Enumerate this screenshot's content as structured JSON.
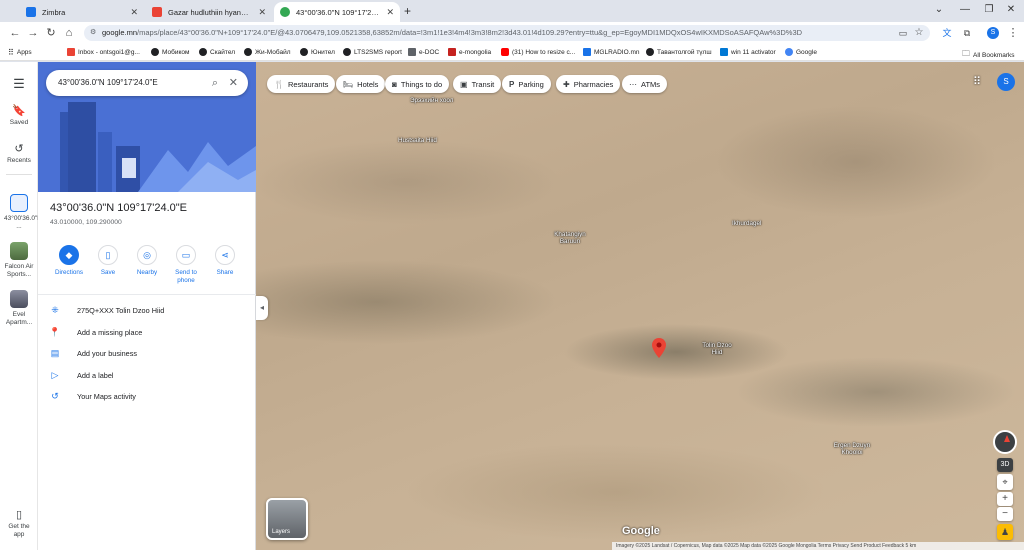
{
  "tabs": [
    {
      "title": "Zimbra",
      "icon_color": "#1a73e8",
      "active": false
    },
    {
      "title": "Gazar hudluthiin hyanasan medee",
      "icon_color": "#ea4335",
      "active": false
    },
    {
      "title": "43°00'36.0\"N 109°17'24.0\"E - Go",
      "icon_color": "#34a853",
      "active": true
    }
  ],
  "new_tab_label": "+",
  "window_controls": {
    "down": "⌄",
    "minimize": "—",
    "maximize": "❐",
    "close": "✕"
  },
  "address": {
    "host": "google.mn",
    "rest": "/maps/place/43°00'36.0\"N+109°17'24.0\"E/@43.0706479,109.0521358,63852m/data=!3m1!1e3!4m4!3m3!8m2!3d43.01!4d109.29?entry=ttu&g_ep=EgoyMDI1MDQxOS4wIKXMDSoASAFQAw%3D%3D"
  },
  "profile_letter": "S",
  "bookmarks": [
    {
      "label": "Apps",
      "color": "#5f6368"
    },
    {
      "label": "Inbox - ontsgoi1@g...",
      "color": "#ea4335"
    },
    {
      "label": "Мобиком",
      "color": "#202124"
    },
    {
      "label": "Скайтел",
      "color": "#202124"
    },
    {
      "label": "Жи-Мобайл",
      "color": "#202124"
    },
    {
      "label": "Юнител",
      "color": "#202124"
    },
    {
      "label": "LTS2SMS report",
      "color": "#202124"
    },
    {
      "label": "e-DOC",
      "color": "#5f6368"
    },
    {
      "label": "e-mongolia",
      "color": "#c5221f"
    },
    {
      "label": "(31) How to resize c...",
      "color": "#ff0000"
    },
    {
      "label": "MGLRADIO.mn",
      "color": "#1a73e8"
    },
    {
      "label": "Тавантолгой түлш",
      "color": "#202124"
    },
    {
      "label": "win 11 activator",
      "color": "#0078d4"
    },
    {
      "label": "Google",
      "color": "#4285f4"
    }
  ],
  "all_bookmarks": "All Bookmarks",
  "rail": {
    "menu_icon": "☰",
    "saved": "Saved",
    "recents": "Recents",
    "recent_items": [
      "43°00'36.0\"N ...",
      "Falcon Air Sports...",
      "Evel Apartm..."
    ],
    "get_app": "Get the app"
  },
  "search": {
    "value": "43°00'36.0\"N 109°17'24.0\"E"
  },
  "place": {
    "title": "43°00'36.0\"N 109°17'24.0\"E",
    "coords": "43.010000, 109.290000"
  },
  "actions": [
    "Directions",
    "Save",
    "Nearby",
    "Send to phone",
    "Share"
  ],
  "info_rows": [
    "275Q+XXX Tolin Dzoo Hiid",
    "Add a missing place",
    "Add your business",
    "Add a label",
    "Your Maps activity"
  ],
  "chips": [
    "Restaurants",
    "Hotels",
    "Things to do",
    "Transit",
    "Parking",
    "Pharmacies",
    "ATMs"
  ],
  "map_labels": [
    {
      "text": "Эрээхийн хоол"
    },
    {
      "text": "Hustsaita Hiid"
    },
    {
      "text": "Khatangiyn Baruun"
    },
    {
      "text": "Ikhurdagel"
    },
    {
      "text": "Tolin Dzoo Hiid"
    },
    {
      "text": "Ergen Dzuyn Khooloi"
    }
  ],
  "layers_label": "Layers",
  "google_logo": "Google",
  "footer": "Imagery ©2025 Landsat / Copernicus, Map data ©2025   Map data ©2025 Google   Mongolia   Terms   Privacy   Send Product Feedback   5 km",
  "map_controls": {
    "three_d": "3D",
    "zoom_in": "+",
    "zoom_out": "−"
  }
}
